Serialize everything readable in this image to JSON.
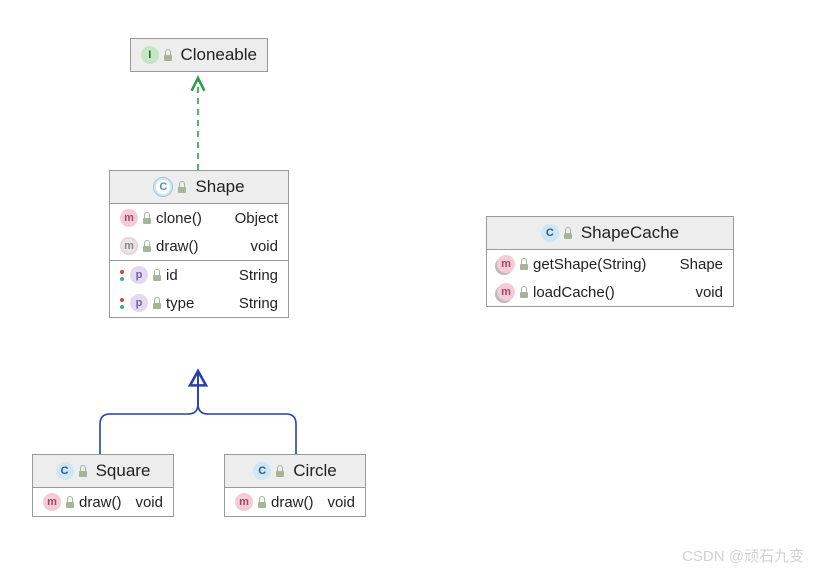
{
  "cloneable": {
    "title": "Cloneable"
  },
  "shape": {
    "title": "Shape",
    "methods": [
      {
        "sig": "clone()",
        "ret": "Object",
        "kind": "m"
      },
      {
        "sig": "draw()",
        "ret": "void",
        "kind": "m-gray"
      }
    ],
    "props": [
      {
        "name": "id",
        "type": "String"
      },
      {
        "name": "type",
        "type": "String"
      }
    ]
  },
  "square": {
    "title": "Square",
    "methods": [
      {
        "sig": "draw()",
        "ret": "void"
      }
    ]
  },
  "circle": {
    "title": "Circle",
    "methods": [
      {
        "sig": "draw()",
        "ret": "void"
      }
    ]
  },
  "shapecache": {
    "title": "ShapeCache",
    "methods": [
      {
        "sig": "getShape(String)",
        "ret": "Shape"
      },
      {
        "sig": "loadCache()",
        "ret": "void"
      }
    ]
  },
  "watermark": "CSDN @顽石九变"
}
